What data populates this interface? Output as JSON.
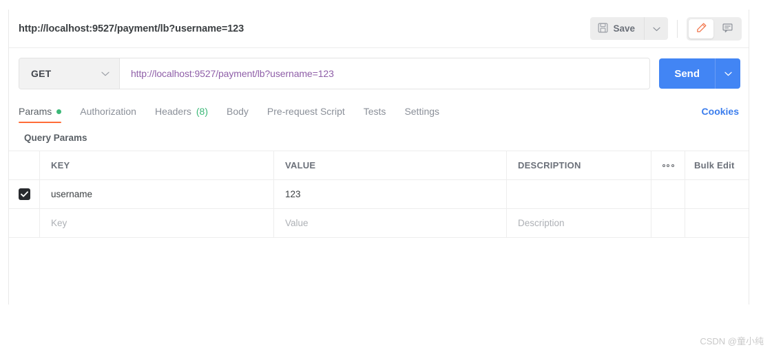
{
  "request": {
    "title": "http://localhost:9527/payment/lb?username=123",
    "method": "GET",
    "url": "http://localhost:9527/payment/lb?username=123",
    "save_label": "Save",
    "send_label": "Send"
  },
  "icons": {
    "save": "floppy-disk-icon",
    "save_caret": "chevron-down-icon",
    "edit": "pencil-icon",
    "comment": "comment-icon",
    "method_caret": "chevron-down-icon",
    "send_caret": "chevron-down-icon",
    "checkbox_check": "check-icon",
    "more": "ellipsis-icon"
  },
  "tabs": [
    {
      "label": "Params",
      "active": true,
      "dot": true,
      "count": ""
    },
    {
      "label": "Authorization",
      "active": false,
      "dot": false,
      "count": ""
    },
    {
      "label": "Headers",
      "active": false,
      "dot": false,
      "count": "(8)"
    },
    {
      "label": "Body",
      "active": false,
      "dot": false,
      "count": ""
    },
    {
      "label": "Pre-request Script",
      "active": false,
      "dot": false,
      "count": ""
    },
    {
      "label": "Tests",
      "active": false,
      "dot": false,
      "count": ""
    },
    {
      "label": "Settings",
      "active": false,
      "dot": false,
      "count": ""
    }
  ],
  "cookies_label": "Cookies",
  "params": {
    "section_title": "Query Params",
    "columns": {
      "key": "KEY",
      "value": "VALUE",
      "description": "DESCRIPTION",
      "bulk_edit": "Bulk Edit"
    },
    "rows": [
      {
        "checked": true,
        "key": "username",
        "value": "123",
        "description": ""
      }
    ],
    "empty_row": {
      "key_placeholder": "Key",
      "value_placeholder": "Value",
      "description_placeholder": "Description"
    }
  },
  "watermark": "CSDN @童小纯",
  "colors": {
    "accent_orange": "#ff6c37",
    "send_blue": "#4285f4",
    "link_blue": "#3b7ded",
    "green_dot": "#3cb878",
    "url_purple": "#8f5fa8"
  }
}
